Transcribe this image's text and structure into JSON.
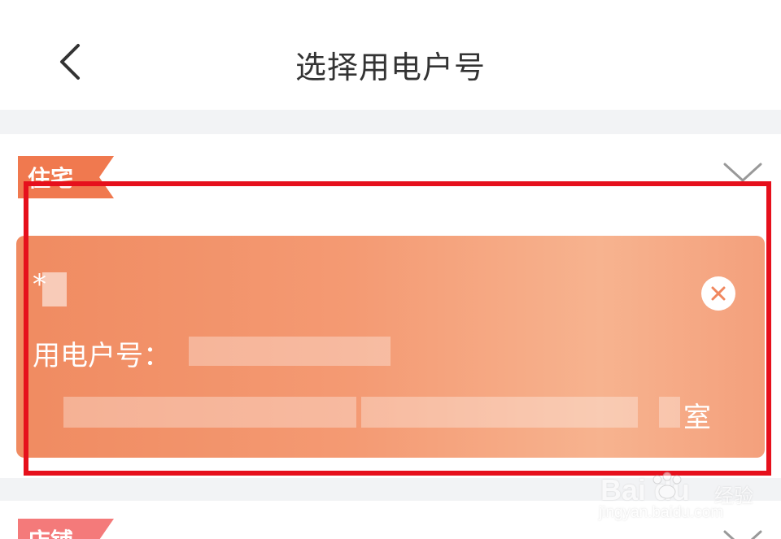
{
  "header": {
    "title": "选择用电户号",
    "back_icon": "chevron-left-icon"
  },
  "section_residential": {
    "tag_label": "住宅",
    "tag_color": "#f0794f",
    "collapse_icon": "chevron-up-icon"
  },
  "account_card": {
    "name_prefix": "*",
    "account_label": "用电户号：",
    "address_suffix": "室",
    "delete_icon": "close-circle-icon",
    "gradient_start": "#f08b61",
    "gradient_end": "#f4a07c"
  },
  "section_shop": {
    "tag_label": "店铺",
    "tag_color": "#f47a7a",
    "collapse_icon": "chevron-up-icon"
  },
  "highlight": {
    "color": "#e6101c"
  },
  "watermark": {
    "logo": "Bai  du",
    "suffix": "经验",
    "url": "jingyan.baidu.com"
  }
}
